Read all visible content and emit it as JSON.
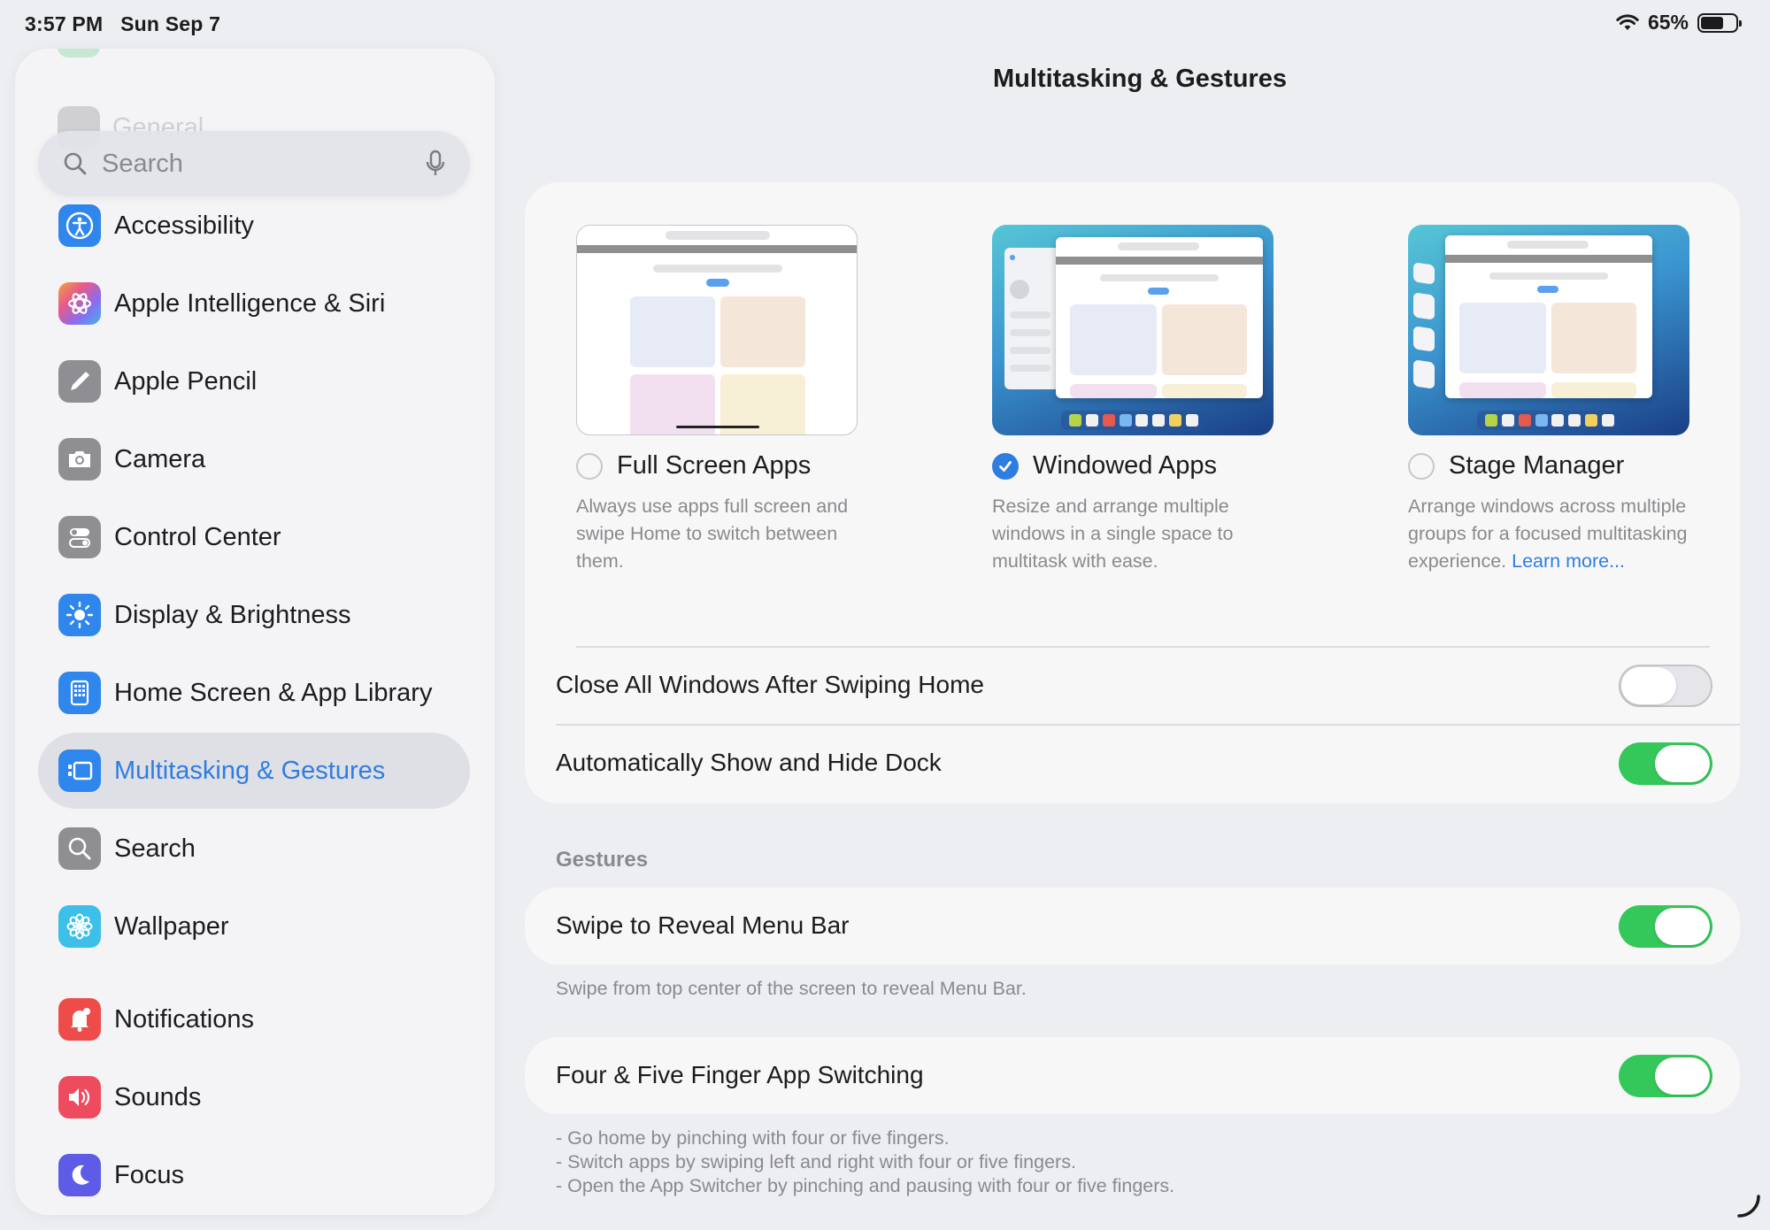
{
  "status_bar": {
    "time": "3:57 PM",
    "date": "Sun Sep 7",
    "battery": "65%",
    "battery_level": 0.65
  },
  "sidebar": {
    "ghost_label": "General",
    "search_placeholder": "Search",
    "items": [
      {
        "label": "Accessibility",
        "icon": "accessibility-icon",
        "color": "#2f86ec"
      },
      {
        "label": "Apple Intelligence & Siri",
        "icon": "siri-icon",
        "color": "#e7705f"
      },
      {
        "label": "Apple Pencil",
        "icon": "pencil-icon",
        "color": "#8e8e93"
      },
      {
        "label": "Camera",
        "icon": "camera-icon",
        "color": "#8e8e93"
      },
      {
        "label": "Control Center",
        "icon": "toggles-icon",
        "color": "#8e8e93"
      },
      {
        "label": "Display & Brightness",
        "icon": "sun-icon",
        "color": "#2f86ec"
      },
      {
        "label": "Home Screen & App Library",
        "icon": "grid-icon",
        "color": "#2f86ec"
      },
      {
        "label": "Multitasking & Gestures",
        "icon": "multitasking-icon",
        "color": "#2f86ec",
        "selected": true
      },
      {
        "label": "Search",
        "icon": "search-icon",
        "color": "#8e8e93"
      },
      {
        "label": "Wallpaper",
        "icon": "flower-icon",
        "color": "#3cbfe8"
      },
      {
        "label": "Notifications",
        "icon": "bell-icon",
        "color": "#ee4b4b"
      },
      {
        "label": "Sounds",
        "icon": "speaker-icon",
        "color": "#ee4b5f"
      },
      {
        "label": "Focus",
        "icon": "moon-icon",
        "color": "#5e5ce6"
      }
    ]
  },
  "main": {
    "title": "Multitasking & Gestures",
    "modes": [
      {
        "label": "Full Screen Apps",
        "desc": "Always use apps full screen and swipe Home to switch between them.",
        "selected": false
      },
      {
        "label": "Windowed Apps",
        "desc": "Resize and arrange multiple windows in a single space to multitask with ease.",
        "selected": true
      },
      {
        "label": "Stage Manager",
        "desc": "Arrange windows across multiple groups for a focused multitasking experience.",
        "learn_more": "Learn more...",
        "selected": false
      }
    ],
    "rows": {
      "close_windows": {
        "label": "Close All Windows After Swiping Home",
        "on": false
      },
      "auto_dock": {
        "label": "Automatically Show and Hide Dock",
        "on": true
      }
    },
    "gestures_header": "Gestures",
    "swipe_menu": {
      "label": "Swipe to Reveal Menu Bar",
      "on": true,
      "footnote": "Swipe from top center of the screen to reveal Menu Bar."
    },
    "four_five": {
      "label": "Four & Five Finger App Switching",
      "on": true,
      "notes": [
        "- Go home by pinching with four or five fingers.",
        "- Switch apps by swiping left and right with four or five fingers.",
        "- Open the App Switcher by pinching and pausing with four or five fingers."
      ]
    }
  }
}
